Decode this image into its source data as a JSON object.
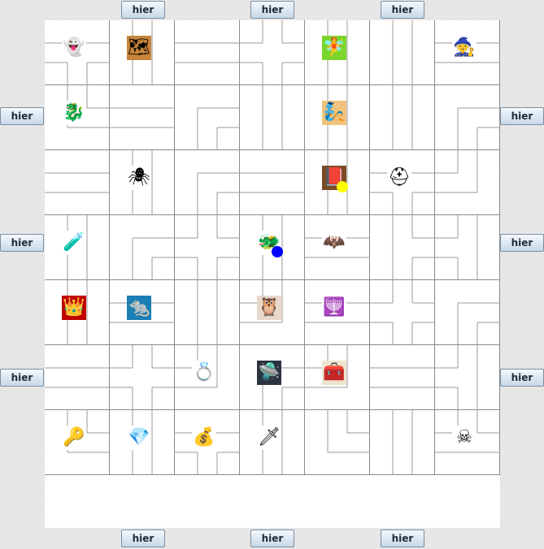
{
  "insert_buttons": {
    "top": [
      "hier",
      "hier",
      "hier"
    ],
    "bottom": [
      "hier",
      "hier",
      "hier"
    ],
    "left": [
      "hier",
      "hier",
      "hier"
    ],
    "right": [
      "hier",
      "hier",
      "hier"
    ]
  },
  "pawns": [
    {
      "color": "#ffff00",
      "row": 2,
      "col": 4
    },
    {
      "color": "#0000ff",
      "row": 3,
      "col": 3
    }
  ],
  "board": {
    "rows": 7,
    "cols": 7,
    "tiles": [
      {
        "row": 0,
        "col": 0,
        "open": [
          "E",
          "W",
          "S"
        ],
        "treasure": "ghost",
        "icon": "👻",
        "bg": "#ffffff"
      },
      {
        "row": 0,
        "col": 1,
        "open": [
          "N",
          "S"
        ],
        "treasure": "treasure-map",
        "icon": "🗺",
        "bg": "#c8843a"
      },
      {
        "row": 0,
        "col": 2,
        "open": [
          "E",
          "W"
        ],
        "treasure": null
      },
      {
        "row": 0,
        "col": 3,
        "open": [
          "N",
          "E",
          "W",
          "S"
        ],
        "treasure": null
      },
      {
        "row": 0,
        "col": 4,
        "open": [
          "N",
          "S"
        ],
        "treasure": "fairy",
        "icon": "🧚",
        "bg": "#7bd62b"
      },
      {
        "row": 0,
        "col": 5,
        "open": [
          "N",
          "S"
        ],
        "treasure": null
      },
      {
        "row": 0,
        "col": 6,
        "open": [
          "E",
          "W"
        ],
        "treasure": "wizard",
        "icon": "🧙",
        "bg": "#ffffff"
      },
      {
        "row": 1,
        "col": 0,
        "open": [
          "N",
          "E"
        ],
        "treasure": "dragon-sketch",
        "icon": "🐉",
        "bg": "#ffffff"
      },
      {
        "row": 1,
        "col": 1,
        "open": [
          "E",
          "W"
        ],
        "treasure": null
      },
      {
        "row": 1,
        "col": 2,
        "open": [
          "E",
          "S"
        ],
        "treasure": null
      },
      {
        "row": 1,
        "col": 3,
        "open": [
          "N",
          "S"
        ],
        "treasure": null
      },
      {
        "row": 1,
        "col": 4,
        "open": [
          "N",
          "S"
        ],
        "treasure": "genie",
        "icon": "🧞",
        "bg": "#f1c27d"
      },
      {
        "row": 1,
        "col": 5,
        "open": [
          "N",
          "S"
        ],
        "treasure": null
      },
      {
        "row": 1,
        "col": 6,
        "open": [
          "E",
          "S"
        ],
        "treasure": null
      },
      {
        "row": 2,
        "col": 0,
        "open": [
          "E",
          "W"
        ],
        "treasure": null
      },
      {
        "row": 2,
        "col": 1,
        "open": [
          "N",
          "S"
        ],
        "treasure": "spider",
        "icon": "🕷",
        "bg": "#ffffff"
      },
      {
        "row": 2,
        "col": 2,
        "open": [
          "E",
          "S"
        ],
        "treasure": null
      },
      {
        "row": 2,
        "col": 3,
        "open": [
          "E",
          "W"
        ],
        "treasure": null
      },
      {
        "row": 2,
        "col": 4,
        "open": [
          "N",
          "S"
        ],
        "treasure": "book",
        "icon": "📕",
        "bg": "#7a4a25"
      },
      {
        "row": 2,
        "col": 5,
        "open": [
          "E",
          "W",
          "S"
        ],
        "treasure": "helmet",
        "icon": "⛑",
        "bg": "#ffffff"
      },
      {
        "row": 2,
        "col": 6,
        "open": [
          "N",
          "W"
        ],
        "treasure": null
      },
      {
        "row": 3,
        "col": 0,
        "open": [
          "N",
          "S"
        ],
        "treasure": "lamp-genie",
        "icon": "🧪",
        "bg": "#ffffff"
      },
      {
        "row": 3,
        "col": 1,
        "open": [
          "E",
          "S"
        ],
        "treasure": null
      },
      {
        "row": 3,
        "col": 2,
        "open": [
          "N",
          "E",
          "W",
          "S"
        ],
        "treasure": null
      },
      {
        "row": 3,
        "col": 3,
        "open": [
          "N",
          "S"
        ],
        "treasure": "dragon",
        "icon": "🐲",
        "bg": "#ffffff"
      },
      {
        "row": 3,
        "col": 4,
        "open": [
          "E",
          "W"
        ],
        "treasure": "bat",
        "icon": "🦇",
        "bg": "#ffffff"
      },
      {
        "row": 3,
        "col": 5,
        "open": [
          "N",
          "E",
          "S"
        ],
        "treasure": null
      },
      {
        "row": 3,
        "col": 6,
        "open": [
          "N",
          "W",
          "S"
        ],
        "treasure": null
      },
      {
        "row": 4,
        "col": 0,
        "open": [
          "N",
          "S"
        ],
        "treasure": "crown",
        "icon": "👑",
        "bg": "#c00000"
      },
      {
        "row": 4,
        "col": 1,
        "open": [
          "E",
          "W"
        ],
        "treasure": "mouse",
        "icon": "🐀",
        "bg": "#1b7fb5"
      },
      {
        "row": 4,
        "col": 2,
        "open": [
          "N",
          "S"
        ],
        "treasure": null
      },
      {
        "row": 4,
        "col": 3,
        "open": [
          "N",
          "W"
        ],
        "treasure": "owl",
        "icon": "🦉",
        "bg": "#e8d8cc"
      },
      {
        "row": 4,
        "col": 4,
        "open": [
          "E",
          "W"
        ],
        "treasure": "candelabra",
        "icon": "🕎",
        "bg": "#ffffff"
      },
      {
        "row": 4,
        "col": 5,
        "open": [
          "N",
          "E",
          "W",
          "S"
        ],
        "treasure": null
      },
      {
        "row": 4,
        "col": 6,
        "open": [
          "E",
          "S"
        ],
        "treasure": null
      },
      {
        "row": 5,
        "col": 0,
        "open": [
          "E",
          "W"
        ],
        "treasure": null
      },
      {
        "row": 5,
        "col": 1,
        "open": [
          "N",
          "E",
          "W",
          "S"
        ],
        "treasure": null
      },
      {
        "row": 5,
        "col": 2,
        "open": [
          "N",
          "W"
        ],
        "treasure": "ring",
        "icon": "💍",
        "bg": "#ffffff"
      },
      {
        "row": 5,
        "col": 3,
        "open": [
          "E",
          "S"
        ],
        "treasure": "ghost-ship",
        "icon": "🛸",
        "bg": "#2b3340"
      },
      {
        "row": 5,
        "col": 4,
        "open": [
          "N",
          "W"
        ],
        "treasure": "treasure-chest",
        "icon": "🧰",
        "bg": "#ede4d0"
      },
      {
        "row": 5,
        "col": 5,
        "open": [
          "E",
          "W"
        ],
        "treasure": null
      },
      {
        "row": 5,
        "col": 6,
        "open": [
          "N",
          "W",
          "S"
        ],
        "treasure": null
      },
      {
        "row": 6,
        "col": 0,
        "open": [
          "N",
          "E"
        ],
        "treasure": "key",
        "icon": "🔑",
        "bg": "#ffffff"
      },
      {
        "row": 6,
        "col": 1,
        "open": [
          "N",
          "S"
        ],
        "treasure": "emerald",
        "icon": "💎",
        "bg": "#ffffff"
      },
      {
        "row": 6,
        "col": 2,
        "open": [
          "E",
          "W",
          "S"
        ],
        "treasure": "money-bag",
        "icon": "💰",
        "bg": "#ffffff"
      },
      {
        "row": 6,
        "col": 3,
        "open": [
          "N",
          "S"
        ],
        "treasure": "sword",
        "icon": "🗡",
        "bg": "#ffffff"
      },
      {
        "row": 6,
        "col": 4,
        "open": [
          "N",
          "E"
        ],
        "treasure": null
      },
      {
        "row": 6,
        "col": 5,
        "open": [
          "N",
          "S"
        ],
        "treasure": null
      },
      {
        "row": 6,
        "col": 6,
        "open": [
          "N",
          "E",
          "W"
        ],
        "treasure": "skull",
        "icon": "☠",
        "bg": "#ffffff"
      }
    ]
  }
}
